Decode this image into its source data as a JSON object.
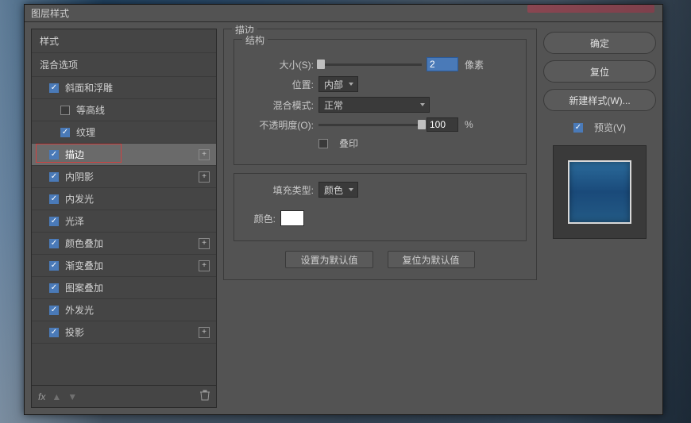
{
  "window": {
    "title": "图层样式"
  },
  "sidebar": {
    "header1": "样式",
    "header2": "混合选项",
    "items": [
      {
        "label": "斜面和浮雕",
        "checked": true,
        "indent": 1,
        "plus": false
      },
      {
        "label": "等高线",
        "checked": false,
        "indent": 2,
        "plus": false
      },
      {
        "label": "纹理",
        "checked": true,
        "indent": 2,
        "plus": false
      },
      {
        "label": "描边",
        "checked": true,
        "indent": 1,
        "plus": true,
        "selected": true,
        "highlight": true
      },
      {
        "label": "内阴影",
        "checked": true,
        "indent": 1,
        "plus": true
      },
      {
        "label": "内发光",
        "checked": true,
        "indent": 1,
        "plus": false
      },
      {
        "label": "光泽",
        "checked": true,
        "indent": 1,
        "plus": false
      },
      {
        "label": "颜色叠加",
        "checked": true,
        "indent": 1,
        "plus": true
      },
      {
        "label": "渐变叠加",
        "checked": true,
        "indent": 1,
        "plus": true
      },
      {
        "label": "图案叠加",
        "checked": true,
        "indent": 1,
        "plus": false
      },
      {
        "label": "外发光",
        "checked": true,
        "indent": 1,
        "plus": false
      },
      {
        "label": "投影",
        "checked": true,
        "indent": 1,
        "plus": true
      }
    ],
    "footer_fx": "fx"
  },
  "main": {
    "group_title": "描边",
    "structure_title": "结构",
    "size_label": "大小(S):",
    "size_value": "2",
    "size_unit": "像素",
    "position_label": "位置:",
    "position_value": "内部",
    "blend_label": "混合模式:",
    "blend_value": "正常",
    "opacity_label": "不透明度(O):",
    "opacity_value": "100",
    "opacity_unit": "%",
    "overprint_label": "叠印",
    "filltype_label": "填充类型:",
    "filltype_value": "颜色",
    "color_label": "颜色:",
    "color_value": "#ffffff",
    "btn_default": "设置为默认值",
    "btn_reset": "复位为默认值"
  },
  "right": {
    "ok": "确定",
    "cancel": "复位",
    "new_style": "新建样式(W)...",
    "preview_label": "预览(V)"
  }
}
